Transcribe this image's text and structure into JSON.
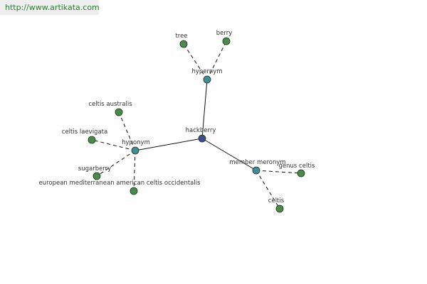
{
  "header": {
    "url": "http://www.artikata.com"
  },
  "colors": {
    "center_node": "#3c4f8c",
    "relation_node": "#3f8f9a",
    "leaf_node": "#4a8a4a",
    "node_stroke": "#1f2f1f",
    "url_text": "#2e7d32"
  },
  "graph": {
    "center": {
      "id": "hackberry",
      "label": "hackberry",
      "kind": "center"
    },
    "relations": [
      {
        "id": "hypernym",
        "label": "hypernym",
        "kind": "relation"
      },
      {
        "id": "hyponym",
        "label": "hyponym",
        "kind": "relation"
      },
      {
        "id": "member-meronym",
        "label": "member meronym",
        "kind": "relation"
      }
    ],
    "leaves": [
      {
        "id": "tree",
        "label": "tree",
        "parent": "hypernym"
      },
      {
        "id": "berry",
        "label": "berry",
        "parent": "hypernym"
      },
      {
        "id": "celtis-australis",
        "label": "celtis australis",
        "parent": "hyponym"
      },
      {
        "id": "celtis-laevigata",
        "label": "celtis laevigata",
        "parent": "hyponym"
      },
      {
        "id": "sugarberry",
        "label": "sugarberry",
        "parent": "hyponym"
      },
      {
        "id": "european-mediterranean",
        "label": "european mediterranean american celtis occidentalis",
        "parent": "hyponym"
      },
      {
        "id": "genus-celtis",
        "label": "genus celtis",
        "parent": "member-meronym"
      },
      {
        "id": "celtis",
        "label": "celtis",
        "parent": "member-meronym"
      }
    ]
  }
}
